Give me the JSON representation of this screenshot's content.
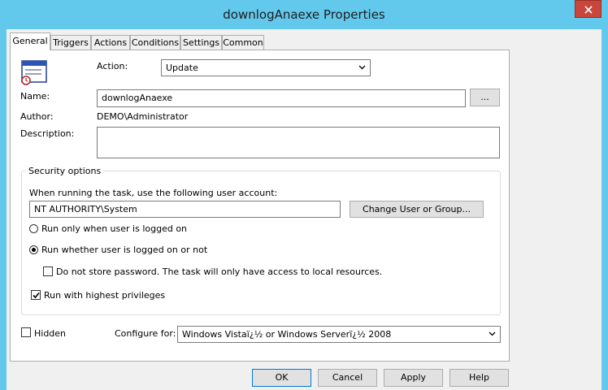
{
  "window": {
    "title": "downlogAnaexe Properties"
  },
  "tabs": [
    {
      "label": "General",
      "active": true
    },
    {
      "label": "Triggers",
      "active": false
    },
    {
      "label": "Actions",
      "active": false
    },
    {
      "label": "Conditions",
      "active": false
    },
    {
      "label": "Settings",
      "active": false
    },
    {
      "label": "Common",
      "active": false
    }
  ],
  "general": {
    "action_label": "Action:",
    "action_value": "Update",
    "name_label": "Name:",
    "name_value": "downlogAnaexe",
    "browse_label": "...",
    "author_label": "Author:",
    "author_value": "DEMO\\Administrator",
    "description_label": "Description:",
    "description_value": ""
  },
  "security": {
    "legend": "Security options",
    "account_prompt": "When running the task, use the following user account:",
    "account_value": "NT AUTHORITY\\System",
    "change_user_label": "Change User or Group...",
    "run_logged_on_label": "Run only when user is logged on",
    "run_logged_on_selected": false,
    "run_whether_label": "Run whether user is logged on or not",
    "run_whether_selected": true,
    "no_store_password_label": "Do not store password. The task will only have access to local resources.",
    "no_store_password_checked": false,
    "highest_privileges_label": "Run with highest privileges",
    "highest_privileges_checked": true
  },
  "bottom": {
    "hidden_label": "Hidden",
    "hidden_checked": false,
    "configure_label": "Configure for:",
    "configure_value": "Windows Vistaï¿½ or Windows Serverï¿½ 2008"
  },
  "buttons": {
    "ok": "OK",
    "cancel": "Cancel",
    "apply": "Apply",
    "help": "Help"
  },
  "colors": {
    "titlebar": "#62c8ec",
    "close_button": "#c9463d",
    "dialog_background": "#f0f0f0",
    "button_face": "#e1e1e1"
  },
  "icons": {
    "task_icon": "scheduled-task-icon",
    "close": "close-icon",
    "dropdown": "chevron-down-icon"
  }
}
